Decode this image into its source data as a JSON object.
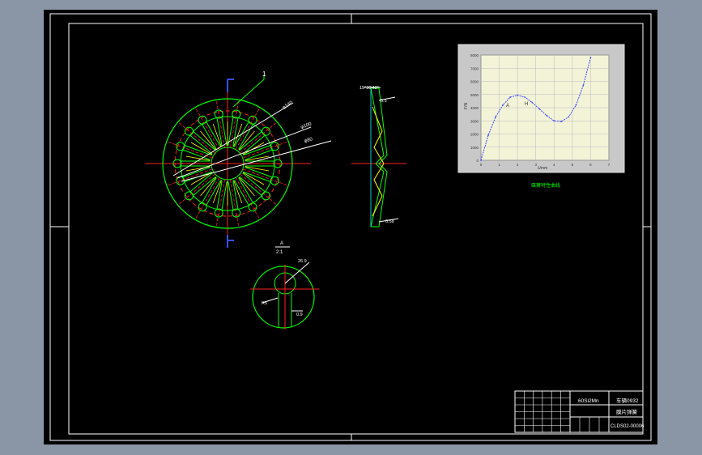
{
  "drawing": {
    "part_label": "1",
    "dims": {
      "angle": "15°30'40\"",
      "tol_top": "0.5",
      "tol_bottom": "0.58",
      "radial_1": "φ140",
      "radial_2": "φ100",
      "radial_3": "φ80",
      "detail_tol": "0.9",
      "detail_width": "26.9",
      "detail_r": "R5"
    },
    "detail_label": "A",
    "detail_scale": "2:1",
    "chart_caption": "碟簧特性曲线",
    "chart_labels": {
      "left_letter": "A",
      "right_letter": "H"
    }
  },
  "colors": {
    "bg": "#000000",
    "green": "#00ff00",
    "red": "#ff2020",
    "yellow": "#ffff00",
    "white": "#ffffff",
    "blue": "#3b4dff",
    "cyan": "#00ffff",
    "plot_bg": "#f3f3d8",
    "chart_panel": "#c8c8c8"
  },
  "title_block": {
    "material": "60Si2Mn",
    "course": "车辆0932",
    "part_name": "膜片弹簧",
    "drawing_no": "CLDS02-00006"
  },
  "chart_data": {
    "type": "line",
    "title": "",
    "xlabel": "λ/mm",
    "ylabel": "F/N",
    "x": [
      0,
      0.4,
      0.8,
      1.2,
      1.6,
      2.0,
      2.4,
      2.8,
      3.2,
      3.6,
      4.0,
      4.4,
      4.8,
      5.2,
      5.6,
      6.0
    ],
    "y": [
      0,
      1900,
      3300,
      4200,
      4800,
      4950,
      4800,
      4400,
      3900,
      3400,
      3000,
      2950,
      3300,
      4200,
      5700,
      7800
    ],
    "xlim": [
      0,
      7
    ],
    "ylim": [
      0,
      8000
    ],
    "grid": true
  }
}
